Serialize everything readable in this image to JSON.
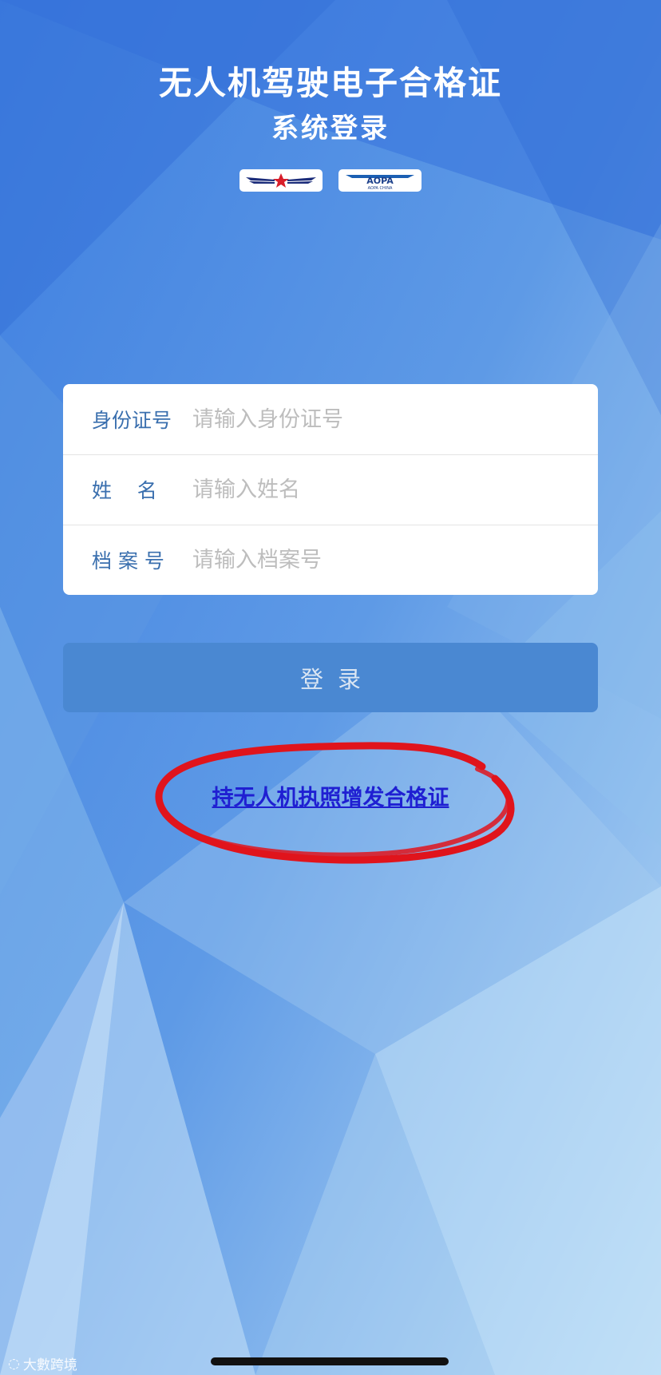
{
  "header": {
    "title": "无人机驾驶电子合格证",
    "subtitle": "系统登录"
  },
  "logos": {
    "left_name": "caac-wings-logo",
    "right_text": "AOPA",
    "right_subtext": "AOPA CHINA"
  },
  "form": {
    "id_label": "身份证号",
    "id_placeholder": "请输入身份证号",
    "name_label": "姓    名",
    "name_placeholder": "请输入姓名",
    "file_label": "档 案 号",
    "file_placeholder": "请输入档案号"
  },
  "login": {
    "label": "登录"
  },
  "link": {
    "label": "持无人机执照增发合格证"
  },
  "watermark": {
    "text": "大數跨境"
  },
  "colors": {
    "background": "#4f8ddd",
    "label": "#3a6fae",
    "button": "#4a88d2",
    "link": "#1f1fd2",
    "annotation": "#e0141c"
  }
}
